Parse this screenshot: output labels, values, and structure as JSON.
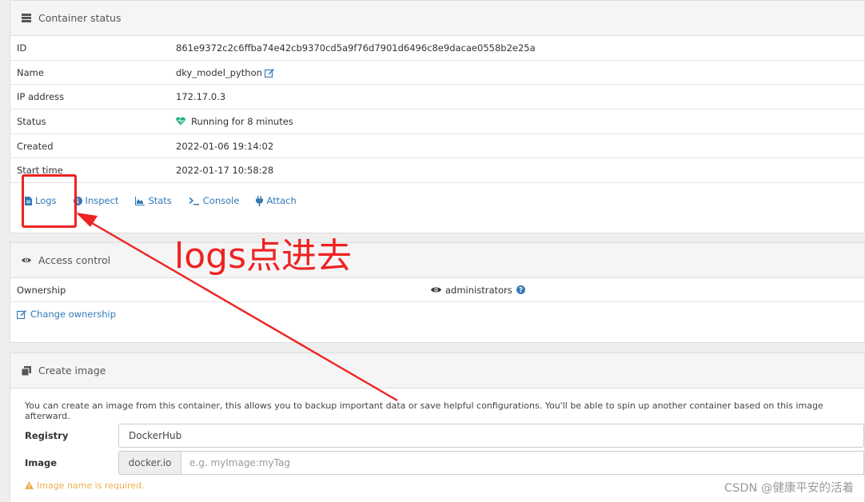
{
  "container_status": {
    "title": "Container status",
    "rows": [
      {
        "key": "ID",
        "value": "861e9372c2c6ffba74e42cb9370cd5a9f76d7901d6496c8e9dacae0558b2e25a"
      },
      {
        "key": "Name",
        "value": "dky_model_python"
      },
      {
        "key": "IP address",
        "value": "172.17.0.3"
      },
      {
        "key": "Status",
        "value": "Running for 8 minutes"
      },
      {
        "key": "Created",
        "value": "2022-01-06 19:14:02"
      },
      {
        "key": "Start time",
        "value": "2022-01-17 10:58:28"
      }
    ],
    "actions": {
      "logs": "Logs",
      "inspect": "Inspect",
      "stats": "Stats",
      "console": "Console",
      "attach": "Attach"
    }
  },
  "access_control": {
    "title": "Access control",
    "ownership_label": "Ownership",
    "ownership_value": "administrators",
    "change_ownership": "Change ownership"
  },
  "create_image": {
    "title": "Create image",
    "help": "You can create an image from this container, this allows you to backup important data or save helpful configurations. You'll be able to spin up another container based on this image afterward.",
    "registry_label": "Registry",
    "registry_value": "DockerHub",
    "image_label": "Image",
    "image_prefix": "docker.io",
    "image_placeholder": "e.g. myImage:myTag",
    "warning": "Image name is required."
  },
  "annotation": {
    "text": "logs点进去",
    "color": "#ee2222"
  },
  "watermark": "CSDN @健康平安的活着",
  "colors": {
    "link": "#337ab7",
    "status_heart": "#23ae89",
    "warning": "#f0ad4e"
  }
}
